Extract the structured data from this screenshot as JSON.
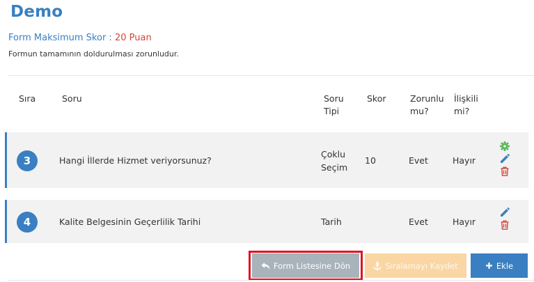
{
  "form": {
    "title": "Demo",
    "max_score_label": "Form Maksimum Skor :",
    "max_score_value": "20 Puan",
    "note": "Formun tamamının doldurulması zorunludur."
  },
  "table": {
    "headers": {
      "order": "Sıra",
      "question": "Soru",
      "type_1": "Soru",
      "type_2": "Tipi",
      "score": "Skor",
      "required_1": "Zorunlu",
      "required_2": "mu?",
      "related_1": "İlişkili",
      "related_2": "mi?"
    },
    "rows": [
      {
        "order": "3",
        "question": "Hangi İllerde Hizmet veriyorsunuz?",
        "type_1": "Çoklu",
        "type_2": "Seçim",
        "score": "10",
        "required": "Evet",
        "related": "Hayır",
        "icons": [
          "gear-icon",
          "pencil-icon",
          "trash-icon"
        ]
      },
      {
        "order": "4",
        "question": "Kalite Belgesinin Geçerlilik Tarihi",
        "type_1": "Tarih",
        "score": "",
        "required": "Evet",
        "related": "Hayır",
        "icons": [
          "pencil-icon",
          "trash-icon"
        ]
      }
    ]
  },
  "buttons": {
    "back": "Form Listesine Dön",
    "save_order": "Sıralamayı Kaydet",
    "add": "Ekle"
  },
  "colors": {
    "primary": "#3a7fc1",
    "danger": "#d4463a",
    "success": "#5cb85c",
    "highlight": "#e0151f"
  }
}
